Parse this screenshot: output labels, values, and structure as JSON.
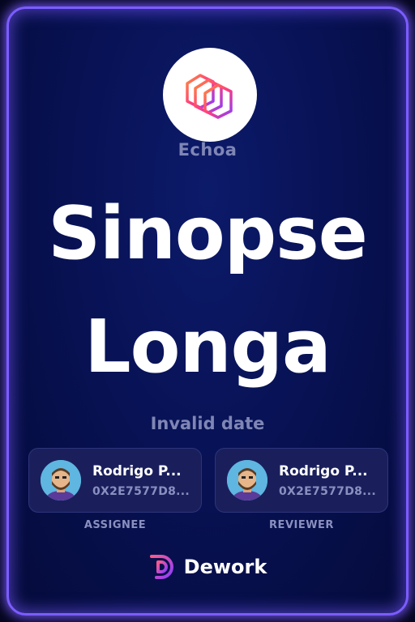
{
  "org": {
    "name": "Echoa"
  },
  "task": {
    "title_line1": "Sinopse",
    "title_line2": "Longa",
    "date": "Invalid date"
  },
  "assignee": {
    "name": "Rodrigo P...",
    "address": "0X2E7577D8...",
    "role": "ASSIGNEE"
  },
  "reviewer": {
    "name": "Rodrigo P...",
    "address": "0X2E7577D8...",
    "role": "REVIEWER"
  },
  "brand": {
    "name": "Dework"
  },
  "icons": {
    "org_logo": "echoa-logo-icon",
    "avatar": "avatar-icon",
    "brand_logo": "dework-logo-icon"
  },
  "colors": {
    "background": "#081255",
    "border_glow": "#7c5cff",
    "muted_text": "#7f86b5",
    "card_bg": "#1a1f5c"
  }
}
